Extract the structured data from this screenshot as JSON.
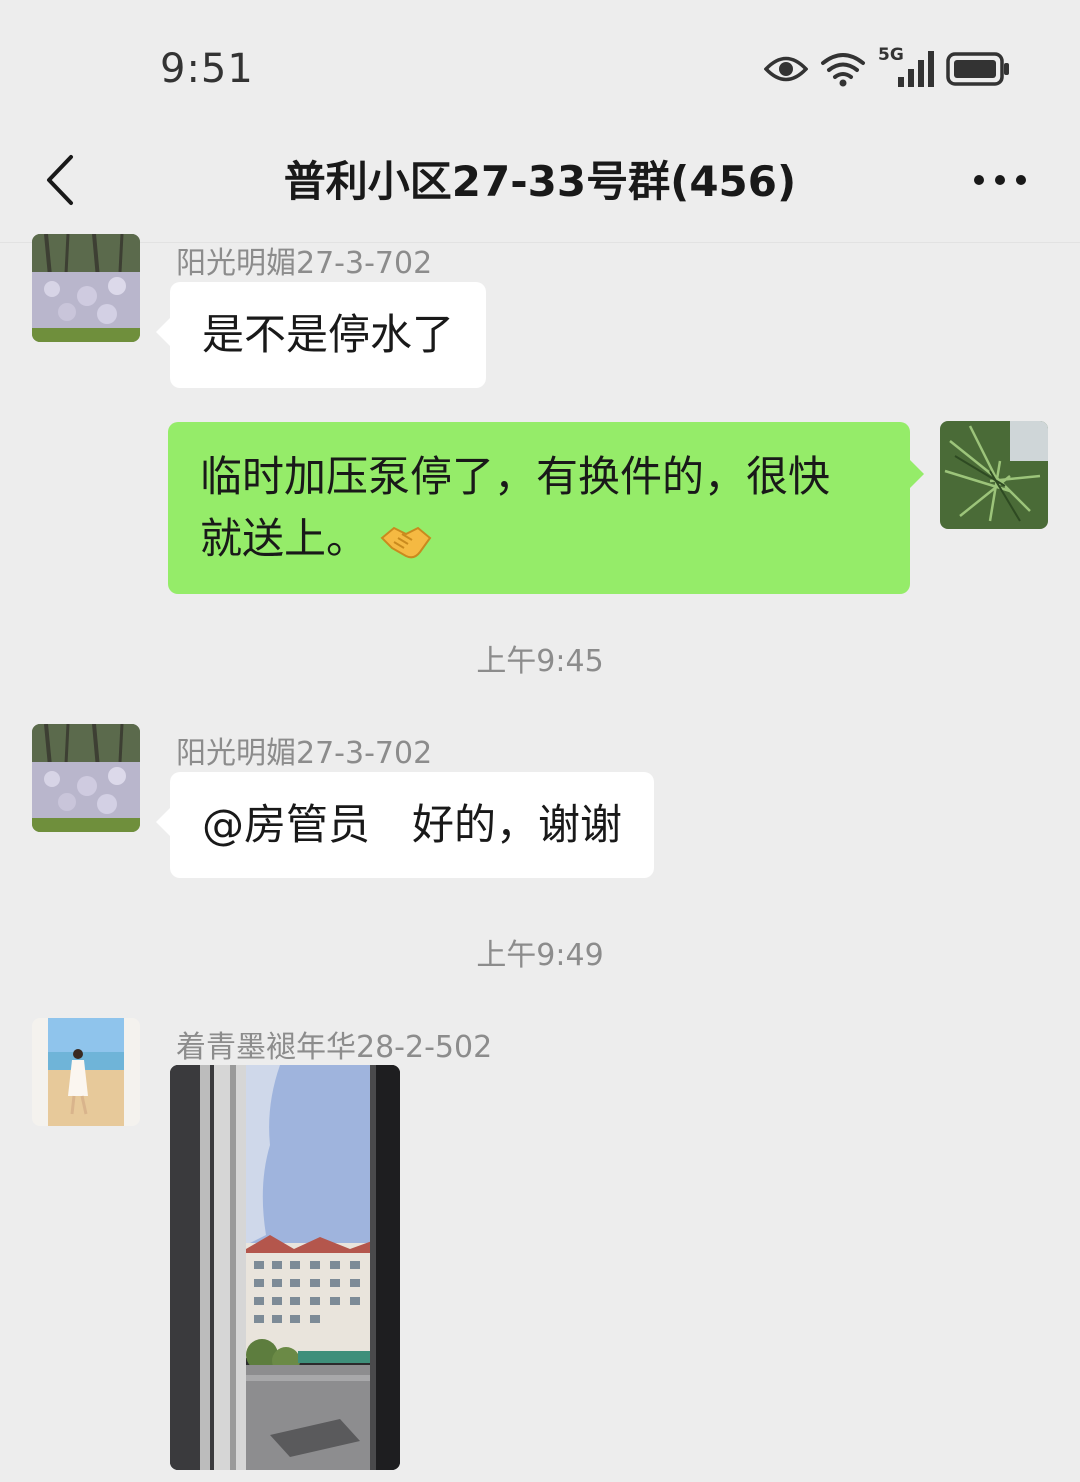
{
  "status_bar": {
    "time": "9:51",
    "network_badge": "5G",
    "icons": [
      "eye-icon",
      "wifi-icon",
      "cellular-signal-icon",
      "battery-icon"
    ]
  },
  "header": {
    "title": "普利小区27-33号群(456)",
    "back_icon": "chevron-left-icon",
    "more_icon": "more-dots-icon"
  },
  "messages": [
    {
      "type": "incoming",
      "sender": "阳光明媚27-3-702",
      "text": "是不是停水了"
    },
    {
      "type": "outgoing",
      "line1": "临时加压泵停了，有换件的，很快",
      "line2": "就送上。",
      "emoji": "handshake-icon"
    },
    {
      "type": "timestamp",
      "text": "上午9:45"
    },
    {
      "type": "incoming",
      "sender": "阳光明媚27-3-702",
      "text": "@房管员　好的，谢谢"
    },
    {
      "type": "timestamp",
      "text": "上午9:49"
    },
    {
      "type": "incoming-image",
      "sender": "着青墨褪年华28-2-502",
      "image": "window-view-photo"
    }
  ],
  "colors": {
    "background": "#ededed",
    "incoming_bubble": "#ffffff",
    "outgoing_bubble": "#95ec69",
    "meta_text": "#8c8c8c"
  }
}
